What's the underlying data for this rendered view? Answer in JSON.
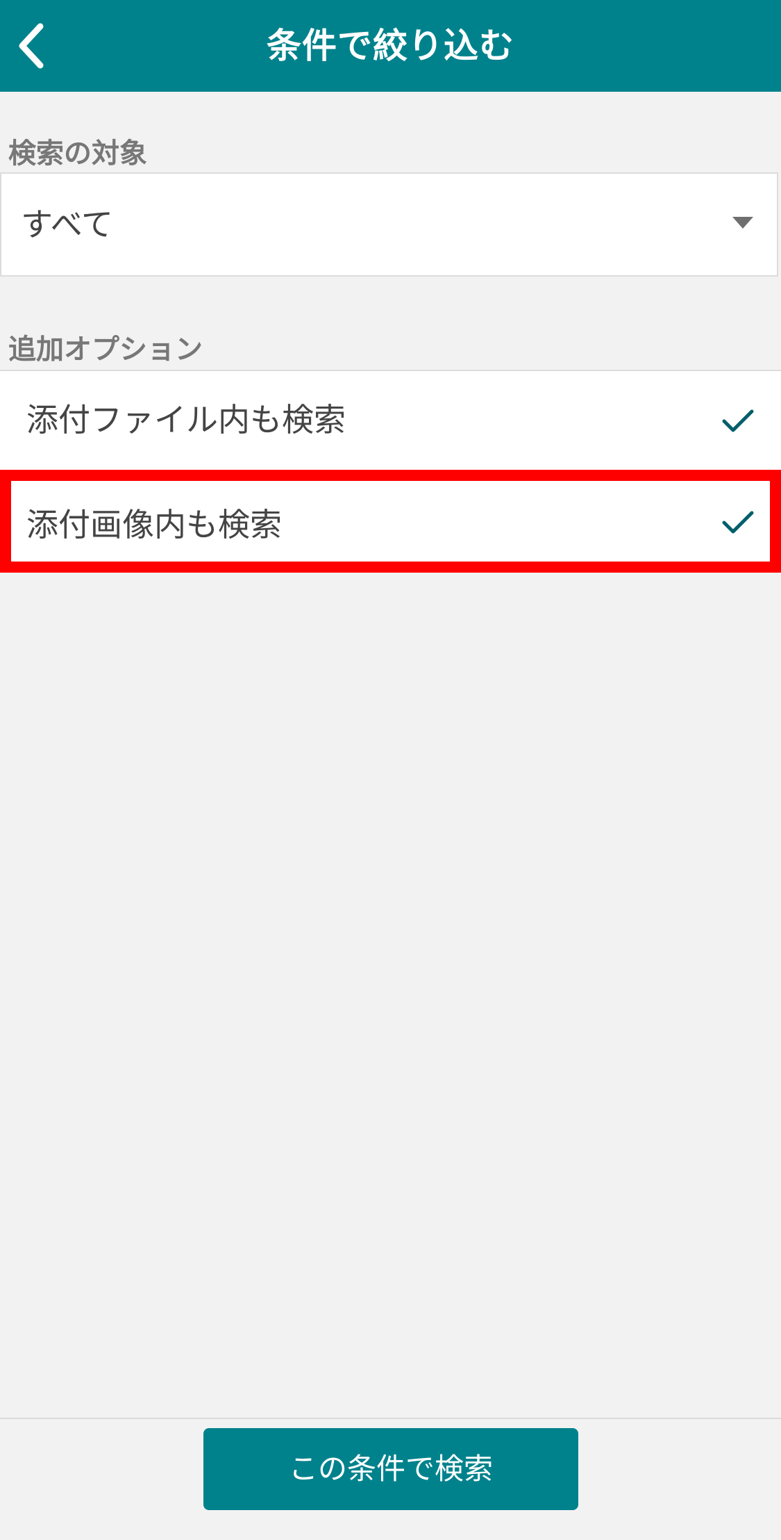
{
  "header": {
    "title": "条件で絞り込む",
    "back_icon": "chevron-left-icon"
  },
  "search_target": {
    "label": "検索の対象",
    "selected": "すべて",
    "arrow_icon": "caret-down-icon"
  },
  "additional_options": {
    "label": "追加オプション",
    "items": [
      {
        "label": "添付ファイル内も検索",
        "checked": true,
        "icon": "check-icon"
      },
      {
        "label": "添付画像内も検索",
        "checked": true,
        "icon": "check-icon",
        "highlighted": true
      }
    ]
  },
  "footer": {
    "search_button": "この条件で検索"
  },
  "colors": {
    "accent": "#00828c",
    "highlight": "#ff0000",
    "check": "#005f6b"
  }
}
